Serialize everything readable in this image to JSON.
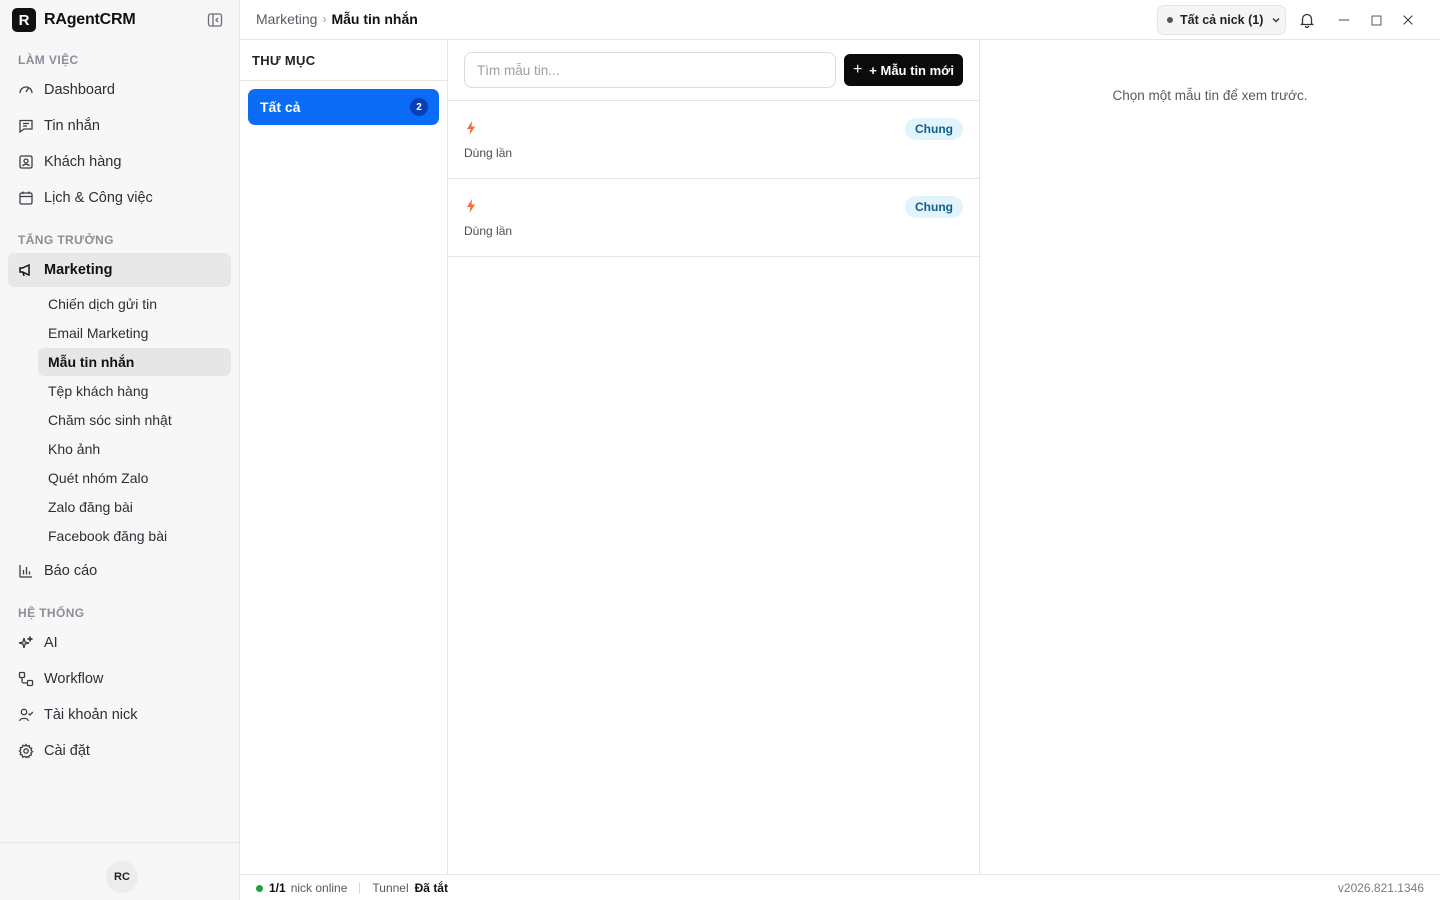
{
  "app": {
    "logo_letter": "R",
    "name": "RAgentCRM"
  },
  "sidebar": {
    "sections": [
      {
        "title": "LÀM VIỆC"
      },
      {
        "title": "TĂNG TRƯỞNG"
      },
      {
        "title": "HỆ THỐNG"
      }
    ],
    "items": [
      {
        "label": "Dashboard",
        "icon": "gauge-icon"
      },
      {
        "label": "Tin nhắn",
        "icon": "message-icon"
      },
      {
        "label": "Khách hàng",
        "icon": "contact-icon"
      },
      {
        "label": "Lịch & Công việc",
        "icon": "calendar-icon"
      },
      {
        "label": "Marketing",
        "icon": "megaphone-icon",
        "active": true
      },
      {
        "label": "Báo cáo",
        "icon": "bar-chart-icon"
      },
      {
        "label": "AI",
        "icon": "sparkles-icon"
      },
      {
        "label": "Workflow",
        "icon": "workflow-icon"
      },
      {
        "label": "Tài khoản nick",
        "icon": "user-check-icon"
      },
      {
        "label": "Cài đặt",
        "icon": "gear-icon"
      }
    ],
    "marketing_subitems": [
      {
        "label": "Chiến dịch gửi tin"
      },
      {
        "label": "Email Marketing"
      },
      {
        "label": "Mẫu tin nhắn",
        "active": true
      },
      {
        "label": "Tệp khách hàng"
      },
      {
        "label": "Chăm sóc sinh nhật"
      },
      {
        "label": "Kho ảnh"
      },
      {
        "label": "Quét nhóm Zalo"
      },
      {
        "label": "Zalo đăng bài"
      },
      {
        "label": "Facebook đăng bài"
      }
    ],
    "avatar_initials": "RC"
  },
  "header": {
    "breadcrumb_parent": "Marketing",
    "breadcrumb_current": "Mẫu tin nhắn",
    "nick_selector": "Tất cả nick (1)"
  },
  "folders": {
    "title": "THƯ MỤC",
    "items": [
      {
        "label": "Tất cả",
        "count": "2"
      }
    ]
  },
  "templates": {
    "search_placeholder": "Tìm mẫu tin...",
    "new_button_label": "+ Mẫu tin mới",
    "items": [
      {
        "tag": "Chung",
        "usage": "Dùng lần"
      },
      {
        "tag": "Chung",
        "usage": "Dùng lần"
      }
    ],
    "accent_color": "#f26b3a"
  },
  "preview": {
    "empty_text": "Chọn một mẫu tin để xem trước."
  },
  "statusbar": {
    "online_count": "1/1",
    "online_label": "nick online",
    "tunnel_label": "Tunnel",
    "tunnel_status": "Đã tắt",
    "version": "v2026.821.1346"
  },
  "colors": {
    "primary": "#0a6cf5",
    "online": "#1fa33a",
    "tag_bg": "#e1f4fb"
  }
}
